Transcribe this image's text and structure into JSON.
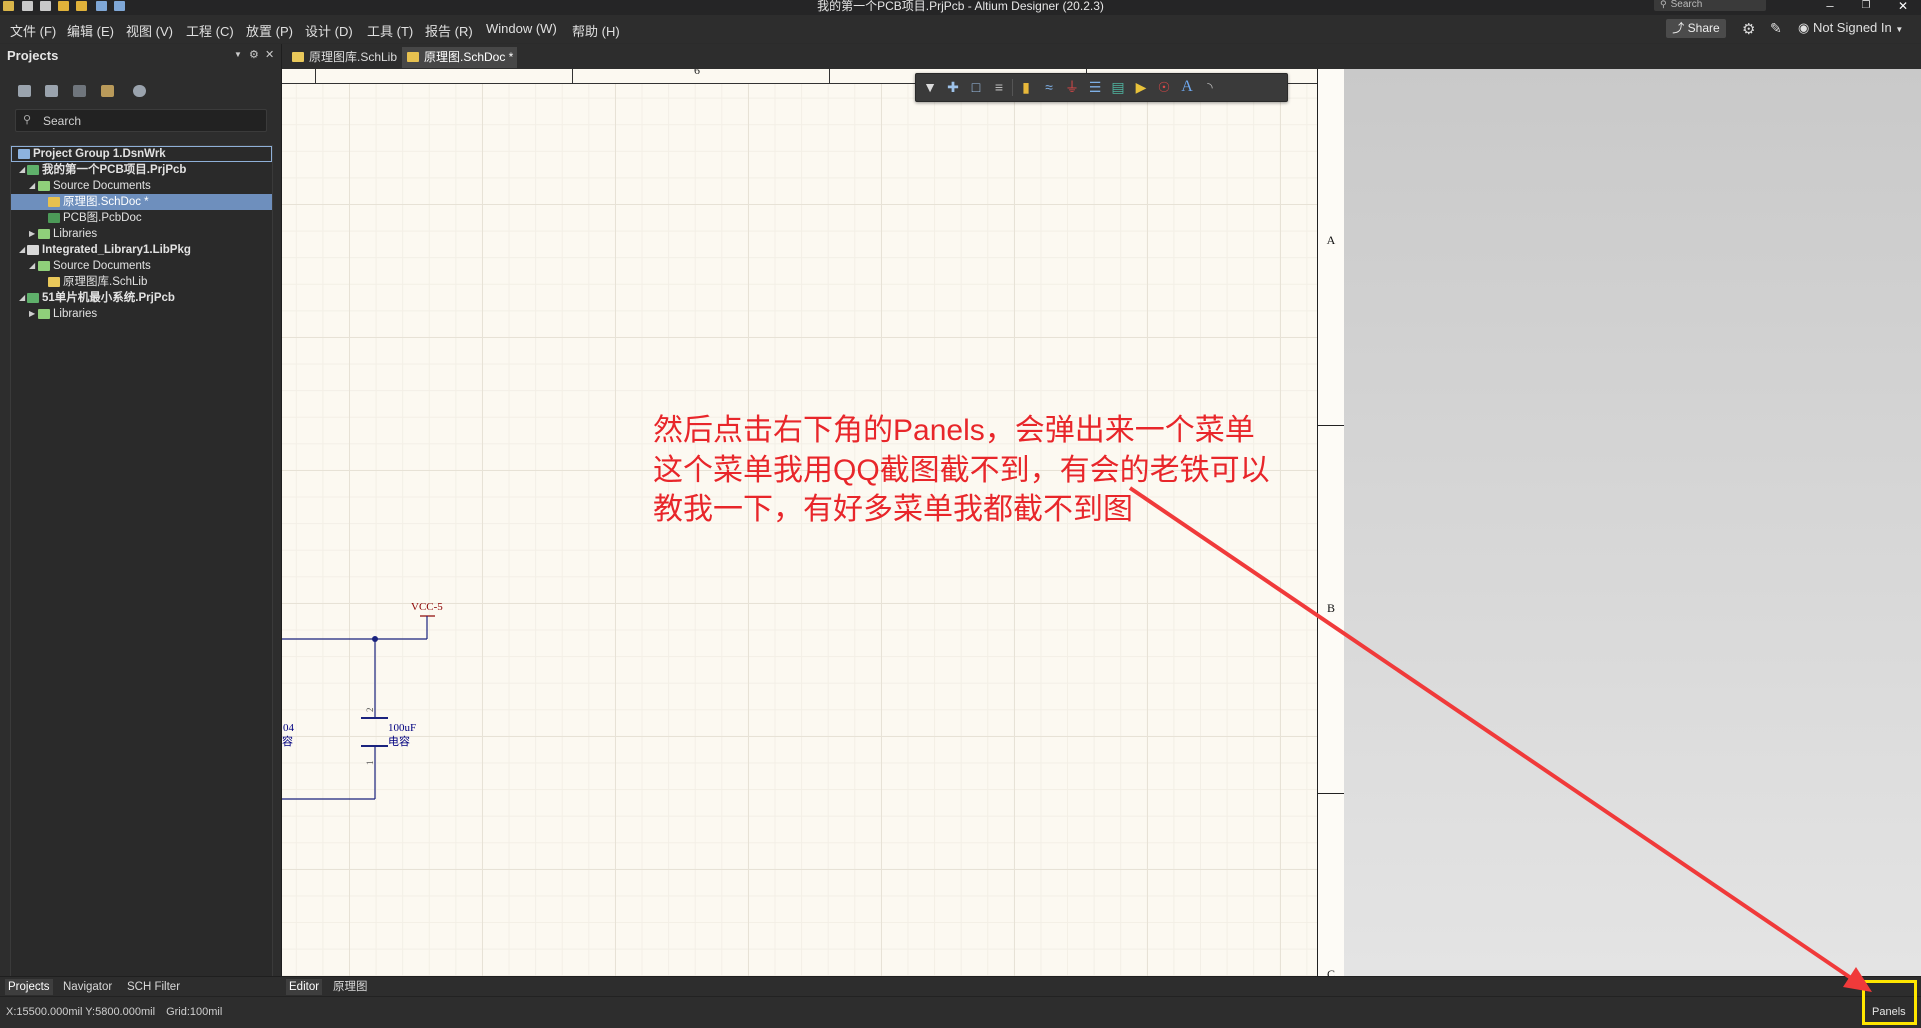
{
  "window": {
    "title": "我的第一个PCB项目.PrjPcb - Altium Designer (20.2.3)",
    "search_placeholder": "Search"
  },
  "menu": {
    "items": [
      "文件 (F)",
      "编辑 (E)",
      "视图 (V)",
      "工程 (C)",
      "放置 (P)",
      "设计 (D)",
      "工具 (T)",
      "报告 (R)",
      "Window (W)",
      "帮助 (H)"
    ]
  },
  "account": {
    "share_label": "Share",
    "user_label": "Not Signed In"
  },
  "projects_panel": {
    "title": "Projects",
    "search_placeholder": "Search",
    "tree": [
      {
        "label": "Project Group 1.DsnWrk",
        "icon": "workspace-icon",
        "level": 0
      },
      {
        "label": "我的第一个PCB项目.PrjPcb",
        "icon": "pcb-project-icon",
        "level": 1,
        "expanded": true,
        "bold": true
      },
      {
        "label": "Source Documents",
        "icon": "folder-icon",
        "level": 2,
        "expanded": true
      },
      {
        "label": "原理图.SchDoc *",
        "icon": "schematic-doc-icon",
        "level": 3,
        "selected": true
      },
      {
        "label": "PCB图.PcbDoc",
        "icon": "pcb-doc-icon",
        "level": 3
      },
      {
        "label": "Libraries",
        "icon": "folder-icon",
        "level": 2,
        "expanded": false
      },
      {
        "label": "Integrated_Library1.LibPkg",
        "icon": "integrated-library-icon",
        "level": 1,
        "expanded": true,
        "bold": true
      },
      {
        "label": "Source Documents",
        "icon": "folder-icon",
        "level": 2,
        "expanded": true
      },
      {
        "label": "原理图库.SchLib",
        "icon": "schlib-icon",
        "level": 3
      },
      {
        "label": "51单片机最小系统.PrjPcb",
        "icon": "pcb-project-icon",
        "level": 1,
        "expanded": true,
        "bold": true
      },
      {
        "label": "Libraries",
        "icon": "folder-icon",
        "level": 2,
        "expanded": false
      }
    ]
  },
  "tabs": [
    {
      "label": "原理图库.SchLib",
      "active": false
    },
    {
      "label": "原理图.SchDoc *",
      "active": true
    }
  ],
  "sheet": {
    "column_label": "6",
    "zone_labels": [
      "A",
      "B",
      "C"
    ]
  },
  "circuit": {
    "power_net": "VCC-5",
    "capacitor": {
      "value": "100uF",
      "type": "电容",
      "pin_top": "2",
      "pin_bottom": "1"
    },
    "left_part": {
      "value_fragment": "04",
      "type_fragment": "容"
    }
  },
  "toolbar_icons": [
    "filter-icon",
    "crosshair-icon",
    "select-rect-icon",
    "align-icon",
    "place-part-icon",
    "wire-icon",
    "power-port-icon",
    "bus-icon",
    "harness-icon",
    "port-icon",
    "directive-icon",
    "text-icon",
    "arc-icon"
  ],
  "annotation": {
    "color": "#e8262a",
    "lines": [
      "然后点击右下角的Panels，会弹出来一个菜单",
      "这个菜单我用QQ截图截不到，有会的老铁可以",
      "教我一下，有好多菜单我都截不到图"
    ]
  },
  "bottom_panel_tabs": [
    "Projects",
    "Navigator",
    "SCH Filter"
  ],
  "editor_tabs": [
    "Editor",
    "原理图"
  ],
  "status": {
    "coordinates": "X:15500.000mil Y:5800.000mil",
    "grid": "Grid:100mil",
    "panels_label": "Panels"
  },
  "highlight_color": "#ffe600"
}
